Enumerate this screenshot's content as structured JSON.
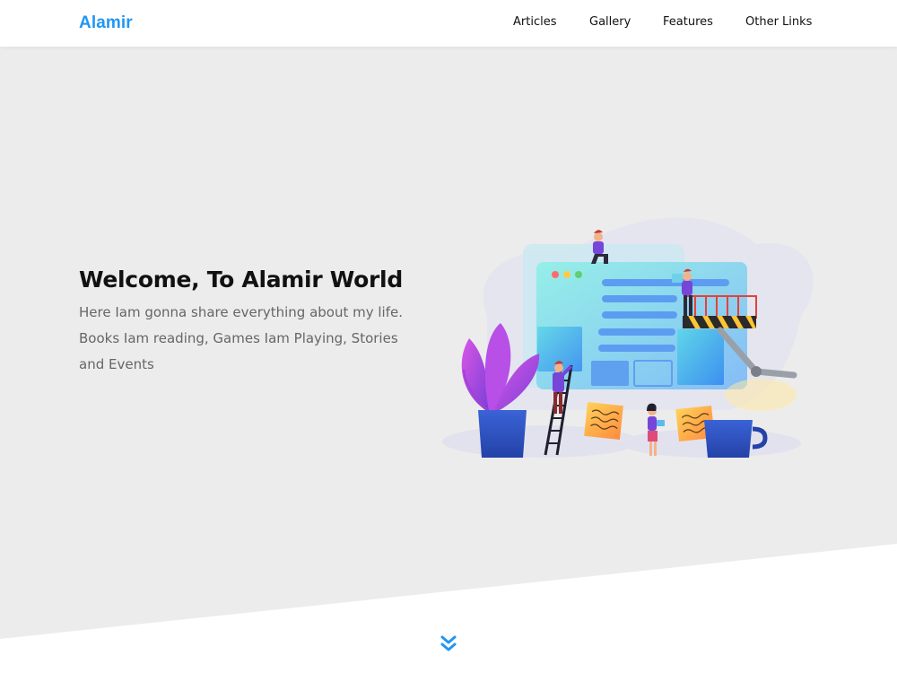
{
  "header": {
    "logo": "Alamir",
    "nav": [
      {
        "label": "Articles"
      },
      {
        "label": "Gallery"
      },
      {
        "label": "Features"
      },
      {
        "label": "Other Links"
      }
    ]
  },
  "hero": {
    "title": "Welcome, To Alamir World",
    "description": "Here Iam gonna share everything about my life. Books Iam reading, Games Iam Playing, Stories and Events"
  },
  "icons": {
    "scroll": "double-chevron-down-icon",
    "illustration": "web-building-team-illustration"
  },
  "colors": {
    "accent": "#2196f3",
    "background": "#ececec",
    "text": "#111111",
    "muted": "#666666"
  }
}
